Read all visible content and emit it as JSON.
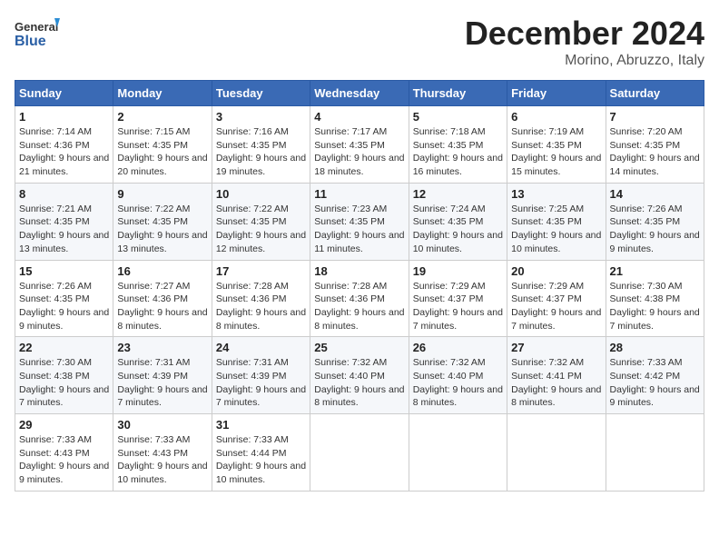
{
  "logo": {
    "general": "General",
    "blue": "Blue"
  },
  "header": {
    "month": "December 2024",
    "location": "Morino, Abruzzo, Italy"
  },
  "weekdays": [
    "Sunday",
    "Monday",
    "Tuesday",
    "Wednesday",
    "Thursday",
    "Friday",
    "Saturday"
  ],
  "weeks": [
    [
      {
        "day": "1",
        "sunrise": "7:14 AM",
        "sunset": "4:36 PM",
        "daylight": "9 hours and 21 minutes."
      },
      {
        "day": "2",
        "sunrise": "7:15 AM",
        "sunset": "4:35 PM",
        "daylight": "9 hours and 20 minutes."
      },
      {
        "day": "3",
        "sunrise": "7:16 AM",
        "sunset": "4:35 PM",
        "daylight": "9 hours and 19 minutes."
      },
      {
        "day": "4",
        "sunrise": "7:17 AM",
        "sunset": "4:35 PM",
        "daylight": "9 hours and 18 minutes."
      },
      {
        "day": "5",
        "sunrise": "7:18 AM",
        "sunset": "4:35 PM",
        "daylight": "9 hours and 16 minutes."
      },
      {
        "day": "6",
        "sunrise": "7:19 AM",
        "sunset": "4:35 PM",
        "daylight": "9 hours and 15 minutes."
      },
      {
        "day": "7",
        "sunrise": "7:20 AM",
        "sunset": "4:35 PM",
        "daylight": "9 hours and 14 minutes."
      }
    ],
    [
      {
        "day": "8",
        "sunrise": "7:21 AM",
        "sunset": "4:35 PM",
        "daylight": "9 hours and 13 minutes."
      },
      {
        "day": "9",
        "sunrise": "7:22 AM",
        "sunset": "4:35 PM",
        "daylight": "9 hours and 13 minutes."
      },
      {
        "day": "10",
        "sunrise": "7:22 AM",
        "sunset": "4:35 PM",
        "daylight": "9 hours and 12 minutes."
      },
      {
        "day": "11",
        "sunrise": "7:23 AM",
        "sunset": "4:35 PM",
        "daylight": "9 hours and 11 minutes."
      },
      {
        "day": "12",
        "sunrise": "7:24 AM",
        "sunset": "4:35 PM",
        "daylight": "9 hours and 10 minutes."
      },
      {
        "day": "13",
        "sunrise": "7:25 AM",
        "sunset": "4:35 PM",
        "daylight": "9 hours and 10 minutes."
      },
      {
        "day": "14",
        "sunrise": "7:26 AM",
        "sunset": "4:35 PM",
        "daylight": "9 hours and 9 minutes."
      }
    ],
    [
      {
        "day": "15",
        "sunrise": "7:26 AM",
        "sunset": "4:35 PM",
        "daylight": "9 hours and 9 minutes."
      },
      {
        "day": "16",
        "sunrise": "7:27 AM",
        "sunset": "4:36 PM",
        "daylight": "9 hours and 8 minutes."
      },
      {
        "day": "17",
        "sunrise": "7:28 AM",
        "sunset": "4:36 PM",
        "daylight": "9 hours and 8 minutes."
      },
      {
        "day": "18",
        "sunrise": "7:28 AM",
        "sunset": "4:36 PM",
        "daylight": "9 hours and 8 minutes."
      },
      {
        "day": "19",
        "sunrise": "7:29 AM",
        "sunset": "4:37 PM",
        "daylight": "9 hours and 7 minutes."
      },
      {
        "day": "20",
        "sunrise": "7:29 AM",
        "sunset": "4:37 PM",
        "daylight": "9 hours and 7 minutes."
      },
      {
        "day": "21",
        "sunrise": "7:30 AM",
        "sunset": "4:38 PM",
        "daylight": "9 hours and 7 minutes."
      }
    ],
    [
      {
        "day": "22",
        "sunrise": "7:30 AM",
        "sunset": "4:38 PM",
        "daylight": "9 hours and 7 minutes."
      },
      {
        "day": "23",
        "sunrise": "7:31 AM",
        "sunset": "4:39 PM",
        "daylight": "9 hours and 7 minutes."
      },
      {
        "day": "24",
        "sunrise": "7:31 AM",
        "sunset": "4:39 PM",
        "daylight": "9 hours and 7 minutes."
      },
      {
        "day": "25",
        "sunrise": "7:32 AM",
        "sunset": "4:40 PM",
        "daylight": "9 hours and 8 minutes."
      },
      {
        "day": "26",
        "sunrise": "7:32 AM",
        "sunset": "4:40 PM",
        "daylight": "9 hours and 8 minutes."
      },
      {
        "day": "27",
        "sunrise": "7:32 AM",
        "sunset": "4:41 PM",
        "daylight": "9 hours and 8 minutes."
      },
      {
        "day": "28",
        "sunrise": "7:33 AM",
        "sunset": "4:42 PM",
        "daylight": "9 hours and 9 minutes."
      }
    ],
    [
      {
        "day": "29",
        "sunrise": "7:33 AM",
        "sunset": "4:43 PM",
        "daylight": "9 hours and 9 minutes."
      },
      {
        "day": "30",
        "sunrise": "7:33 AM",
        "sunset": "4:43 PM",
        "daylight": "9 hours and 10 minutes."
      },
      {
        "day": "31",
        "sunrise": "7:33 AM",
        "sunset": "4:44 PM",
        "daylight": "9 hours and 10 minutes."
      },
      null,
      null,
      null,
      null
    ]
  ]
}
